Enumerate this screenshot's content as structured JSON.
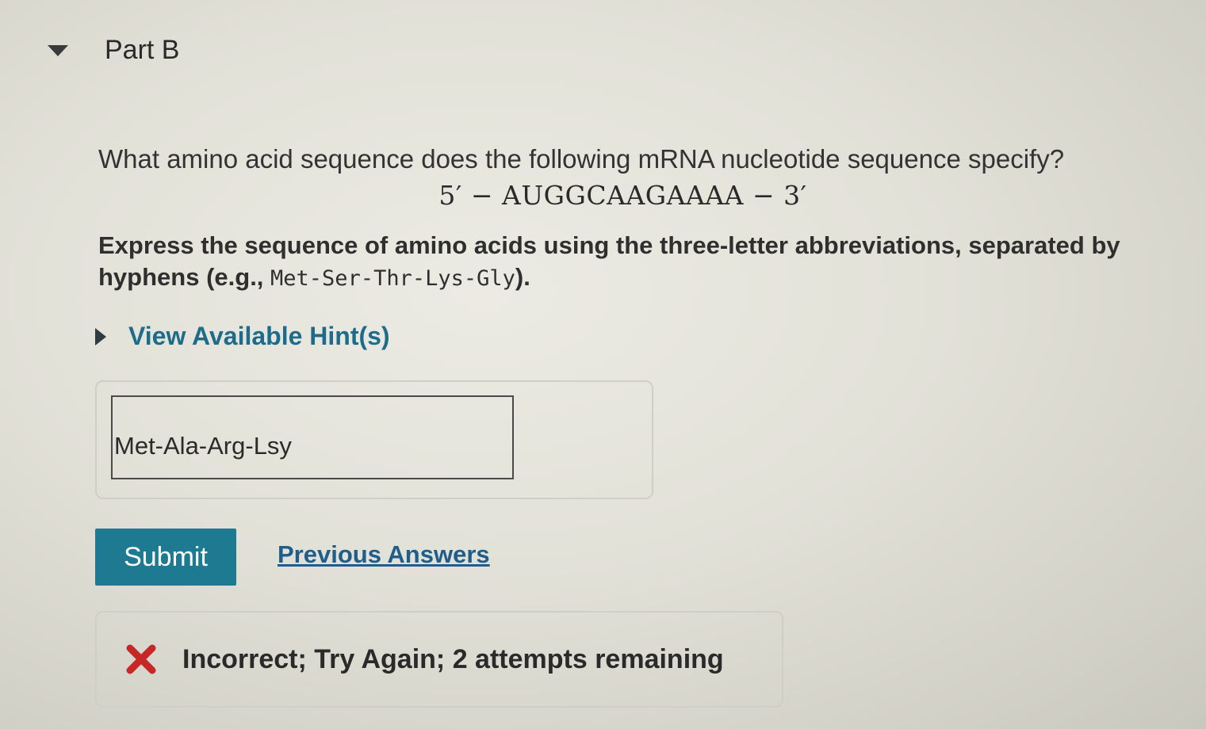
{
  "part": {
    "title": "Part B",
    "collapse_icon": "triangle-down-icon"
  },
  "question": {
    "prompt": "What amino acid sequence does the following mRNA nucleotide sequence specify?",
    "sequence": "5′ − AUGGCAAGAAAA − 3′",
    "instruction_text": "Express the sequence of amino acids using the three-letter abbreviations, separated by hyphens (e.g., ",
    "instruction_example": "Met-Ser-Thr-Lys-Gly",
    "instruction_end": ")."
  },
  "hints": {
    "label": "View Available Hint(s)",
    "icon": "triangle-right-icon"
  },
  "answer": {
    "value": "Met-Ala-Arg-Lsy"
  },
  "actions": {
    "submit_label": "Submit",
    "previous_answers_label": "Previous Answers"
  },
  "feedback": {
    "icon": "x-icon",
    "icon_color": "#c62828",
    "text": "Incorrect; Try Again; 2 attempts remaining"
  },
  "colors": {
    "accent": "#1e7a91",
    "link": "#1f6b8a"
  }
}
